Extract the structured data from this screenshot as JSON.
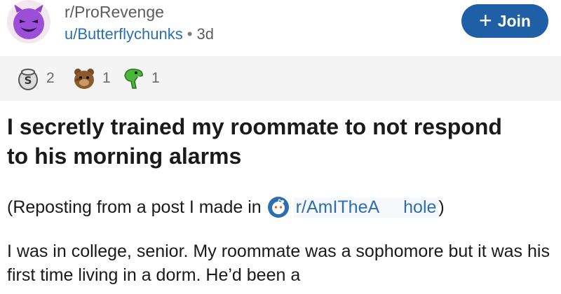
{
  "post": {
    "subreddit": "r/ProRevenge",
    "author": "u/Butterflychunks",
    "separator": "•",
    "age": "3d",
    "join_label": "Join",
    "join_icon": "plus-icon"
  },
  "awards": [
    {
      "icon": "silver-award-icon",
      "count": "2"
    },
    {
      "icon": "bear-award-icon",
      "count": "1"
    },
    {
      "icon": "dinosaur-award-icon",
      "count": "1"
    }
  ],
  "title": "I secretly trained my roommate to not respond to his morning alarms",
  "repost": {
    "prefix": "(Reposting from a post I made in",
    "sub_part1": "r/AmITheA",
    "sub_part2": "hole",
    "suffix": ")"
  },
  "body": "I was in college, senior. My roommate was a sophomore but it was his first time living in a dorm. He’d been a",
  "colors": {
    "link": "#2b6fb0",
    "join_button": "#1f5fa6",
    "awards_bar": "#f4f4f4"
  }
}
